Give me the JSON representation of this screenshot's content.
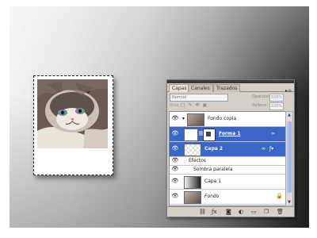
{
  "photo": {
    "image_name": "cat photo"
  },
  "layers_panel": {
    "tabs": [
      "Capas",
      "Canales",
      "Trazados"
    ],
    "blend_mode": "Normal",
    "opacity_label": "Opacidad:",
    "opacity_value": "100%",
    "lock_label": "Bloq.:",
    "fill_label": "Relleno:",
    "fill_value": "100%",
    "layers": [
      {
        "name": "Fondo copia"
      },
      {
        "name": "Forma 1"
      },
      {
        "name": "Capa 2"
      },
      {
        "name": "Efectos"
      },
      {
        "name": "Sombra paralela"
      },
      {
        "name": "Capa 1"
      },
      {
        "name": "Fondo"
      }
    ]
  },
  "icons": {
    "eye": "eye-icon",
    "link": "link-icon",
    "fx": "fx-icon",
    "lock": "lock-icon",
    "menu": "panel-menu-icon",
    "bottom": [
      "link-layers-icon",
      "fx-icon",
      "mask-icon",
      "adjustment-icon",
      "group-icon",
      "new-layer-icon",
      "trash-icon"
    ]
  },
  "colors": {
    "selected_layer": "#3a66c8",
    "panel_bg": "#d4d0c8"
  }
}
